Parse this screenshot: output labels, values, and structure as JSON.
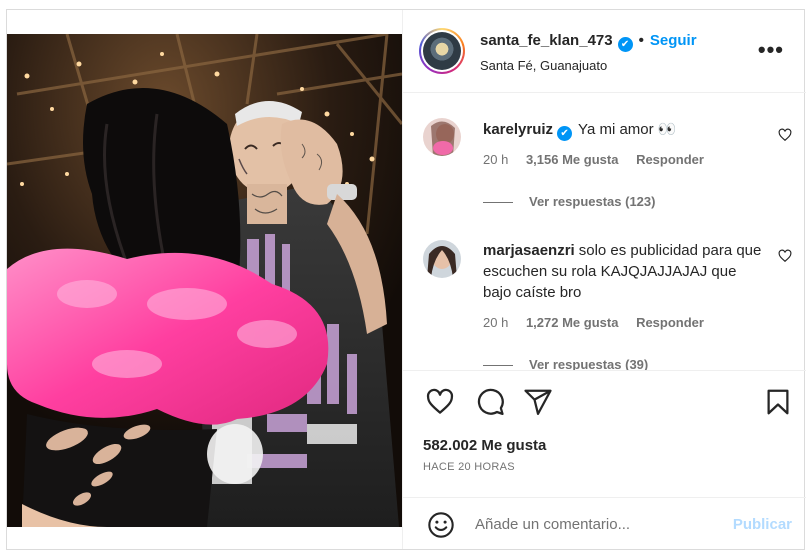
{
  "post": {
    "author": {
      "username": "santa_fe_klan_473",
      "verified_icon": "verified-badge-icon",
      "separator": "•",
      "follow_label": "Seguir",
      "location": "Santa Fé, Guanajuato",
      "more_icon": "more-options-icon",
      "more_glyph": "•••"
    },
    "comments": [
      {
        "username": "karelyruiz",
        "verified": true,
        "text": "Ya mi amor 👀",
        "age": "20 h",
        "likes": "3,156 Me gusta",
        "reply_label": "Responder",
        "view_replies": "Ver respuestas (123)"
      },
      {
        "username": "marjasaenzri",
        "verified": false,
        "text": "solo es publicidad para que escuchen su rola KAJQJAJJAJAJ que bajo caíste bro",
        "age": "20 h",
        "likes": "1,272 Me gusta",
        "reply_label": "Responder",
        "view_replies": "Ver respuestas (39)"
      }
    ],
    "actions": {
      "icons": [
        "heart-icon",
        "comment-icon",
        "share-icon",
        "bookmark-icon"
      ],
      "likes": "582.002 Me gusta",
      "posted": "HACE 20 HORAS"
    },
    "composer": {
      "emoji_icon": "emoji-icon",
      "placeholder": "Añade un comentario...",
      "publish_label": "Publicar"
    }
  },
  "colors": {
    "accent": "#0095f6",
    "publish_disabled": "#b3dbff",
    "muted": "#737373",
    "text": "#262626",
    "border": "#dbdbdb"
  }
}
